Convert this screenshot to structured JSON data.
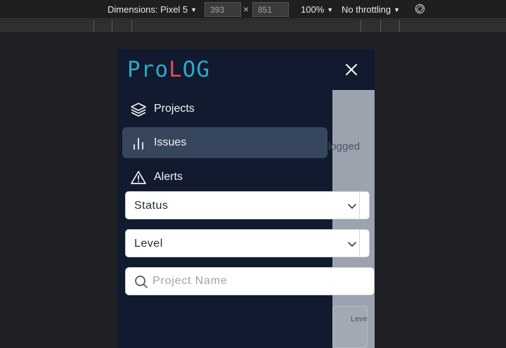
{
  "devtools": {
    "dimensions_label": "Dimensions: Pixel 5",
    "width_value": "393",
    "height_value": "851",
    "times_symbol": "×",
    "zoom_label": "100%",
    "throttling_label": "No throttling",
    "rotate_icon": "rotate-icon"
  },
  "app": {
    "logo_part1": "Pro",
    "logo_part2": "L",
    "logo_part3": "OG",
    "logo_part4": "",
    "close_icon": "close-icon"
  },
  "nav": {
    "items": [
      {
        "label": "Projects",
        "icon": "layers-icon",
        "active": false
      },
      {
        "label": "Issues",
        "icon": "bar-chart-icon",
        "active": true
      },
      {
        "label": "Alerts",
        "icon": "alert-triangle-icon",
        "active": false
      }
    ]
  },
  "filters": {
    "status_label": "Status",
    "level_label": "Level",
    "search_placeholder": "Project Name"
  },
  "background": {
    "partial_text": "logged",
    "partial_column": "Leve"
  },
  "colors": {
    "drawer_bg": "#111a2e",
    "active_item_bg": "#36465c",
    "logo_blue": "#2ea8c9",
    "logo_red": "#e04b5a"
  }
}
